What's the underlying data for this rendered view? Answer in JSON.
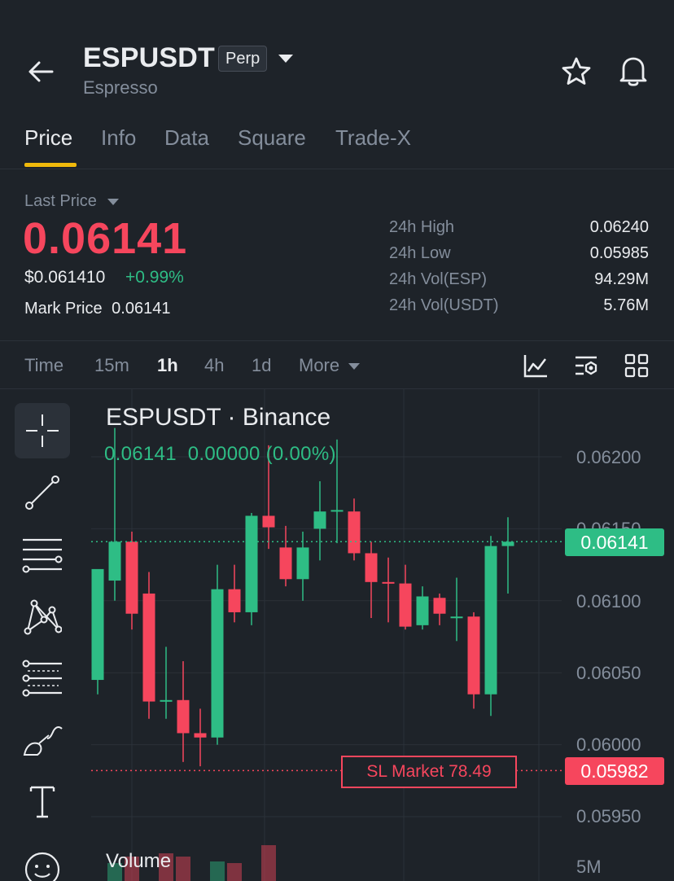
{
  "header": {
    "symbol": "ESPUSDT",
    "badge": "Perp",
    "subtitle": "Espresso"
  },
  "tabs": [
    {
      "label": "Price",
      "active": true
    },
    {
      "label": "Info",
      "active": false
    },
    {
      "label": "Data",
      "active": false
    },
    {
      "label": "Square",
      "active": false
    },
    {
      "label": "Trade-X",
      "active": false
    }
  ],
  "price": {
    "label": "Last Price",
    "last": "0.06141",
    "usd": "$0.061410",
    "change": "+0.99%",
    "mark_label": "Mark Price",
    "mark_value": "0.06141"
  },
  "stats": [
    {
      "label": "24h High",
      "value": "0.06240"
    },
    {
      "label": "24h Low",
      "value": "0.05985"
    },
    {
      "label": "24h Vol(ESP)",
      "value": "94.29M"
    },
    {
      "label": "24h Vol(USDT)",
      "value": "5.76M"
    }
  ],
  "timeframes": [
    {
      "label": "Time",
      "active": false
    },
    {
      "label": "15m",
      "active": false
    },
    {
      "label": "1h",
      "active": true
    },
    {
      "label": "4h",
      "active": false
    },
    {
      "label": "1d",
      "active": false
    },
    {
      "label": "More",
      "active": false
    }
  ],
  "chart": {
    "title": "ESPUSDT · Binance",
    "ohlc_text": "0.06141  0.00000 (0.00%)",
    "current_price_tag": "0.06141",
    "sl_price_tag": "0.05982",
    "sl_label": "SL Market 78.49",
    "volume_label": "Volume",
    "volume_axis": "5M"
  },
  "colors": {
    "up": "#2ebd85",
    "down": "#f6465d",
    "accent": "#f0b90b",
    "background": "#1e2329"
  },
  "chart_data": {
    "type": "candlestick",
    "title": "ESPUSDT · Binance",
    "y_ticks": [
      "0.06200",
      "0.06150",
      "0.06100",
      "0.06050",
      "0.06000",
      "0.05950"
    ],
    "ylim": [
      0.0592,
      0.0625
    ],
    "candles": [
      {
        "o": 0.06045,
        "h": 0.0611,
        "l": 0.06035,
        "c": 0.06122
      },
      {
        "o": 0.06114,
        "h": 0.0622,
        "l": 0.061,
        "c": 0.06141
      },
      {
        "o": 0.06141,
        "h": 0.06148,
        "l": 0.0608,
        "c": 0.06091
      },
      {
        "o": 0.06105,
        "h": 0.0612,
        "l": 0.06018,
        "c": 0.0603
      },
      {
        "o": 0.0603,
        "h": 0.06068,
        "l": 0.06018,
        "c": 0.06031
      },
      {
        "o": 0.06031,
        "h": 0.06058,
        "l": 0.05988,
        "c": 0.06008
      },
      {
        "o": 0.06008,
        "h": 0.06025,
        "l": 0.05985,
        "c": 0.06005
      },
      {
        "o": 0.06005,
        "h": 0.06125,
        "l": 0.06,
        "c": 0.06108
      },
      {
        "o": 0.06108,
        "h": 0.06125,
        "l": 0.06085,
        "c": 0.06092
      },
      {
        "o": 0.06092,
        "h": 0.06161,
        "l": 0.06083,
        "c": 0.06159
      },
      {
        "o": 0.06159,
        "h": 0.06208,
        "l": 0.06136,
        "c": 0.06151
      },
      {
        "o": 0.06137,
        "h": 0.06152,
        "l": 0.0611,
        "c": 0.06115
      },
      {
        "o": 0.06115,
        "h": 0.06148,
        "l": 0.061,
        "c": 0.06137
      },
      {
        "o": 0.0615,
        "h": 0.06183,
        "l": 0.06128,
        "c": 0.06162
      },
      {
        "o": 0.06162,
        "h": 0.06212,
        "l": 0.0614,
        "c": 0.06163
      },
      {
        "o": 0.06162,
        "h": 0.06171,
        "l": 0.06128,
        "c": 0.06133
      },
      {
        "o": 0.06133,
        "h": 0.06141,
        "l": 0.06088,
        "c": 0.06113
      },
      {
        "o": 0.06113,
        "h": 0.0613,
        "l": 0.06085,
        "c": 0.06112
      },
      {
        "o": 0.06112,
        "h": 0.06125,
        "l": 0.0608,
        "c": 0.06082
      },
      {
        "o": 0.06083,
        "h": 0.0611,
        "l": 0.0608,
        "c": 0.06103
      },
      {
        "o": 0.06102,
        "h": 0.06105,
        "l": 0.06083,
        "c": 0.06091
      },
      {
        "o": 0.06089,
        "h": 0.06116,
        "l": 0.06072,
        "c": 0.06089
      },
      {
        "o": 0.06089,
        "h": 0.06092,
        "l": 0.06025,
        "c": 0.06035
      },
      {
        "o": 0.06035,
        "h": 0.06145,
        "l": 0.0602,
        "c": 0.06138
      },
      {
        "o": 0.06138,
        "h": 0.06158,
        "l": 0.06105,
        "c": 0.06141
      }
    ],
    "current_price": 0.06141,
    "sl_price": 0.05982
  }
}
